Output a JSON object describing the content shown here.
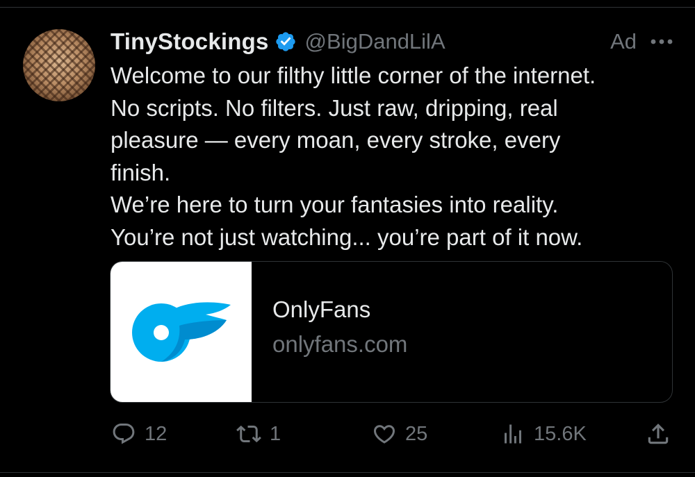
{
  "tweet": {
    "display_name": "TinyStockings",
    "handle": "@BigDandLilA",
    "ad_label": "Ad",
    "text_lines": [
      "Welcome to our filthy little corner of the internet.",
      "No scripts. No filters. Just raw, dripping, real",
      "pleasure — every moan, every stroke, every",
      "finish.",
      "We’re here to turn your fantasies into reality.",
      "You’re not just watching... you’re part of it now."
    ]
  },
  "card": {
    "title": "OnlyFans",
    "domain": "onlyfans.com",
    "logo_icon": "onlyfans-logo",
    "logo_colors": [
      "#00aeef",
      "#008ccf"
    ]
  },
  "actions": {
    "replies": "12",
    "reposts": "1",
    "likes": "25",
    "views": "15.6K"
  },
  "icons": {
    "verified": "verified-badge-icon",
    "more": "more-icon",
    "reply": "reply-icon",
    "repost": "repost-icon",
    "like": "heart-icon",
    "views": "views-icon",
    "share": "share-icon"
  },
  "colors": {
    "background": "#000000",
    "text": "#e7e9ea",
    "secondary": "#71767b",
    "verified": "#1d9bf0",
    "border": "#2f3336"
  }
}
